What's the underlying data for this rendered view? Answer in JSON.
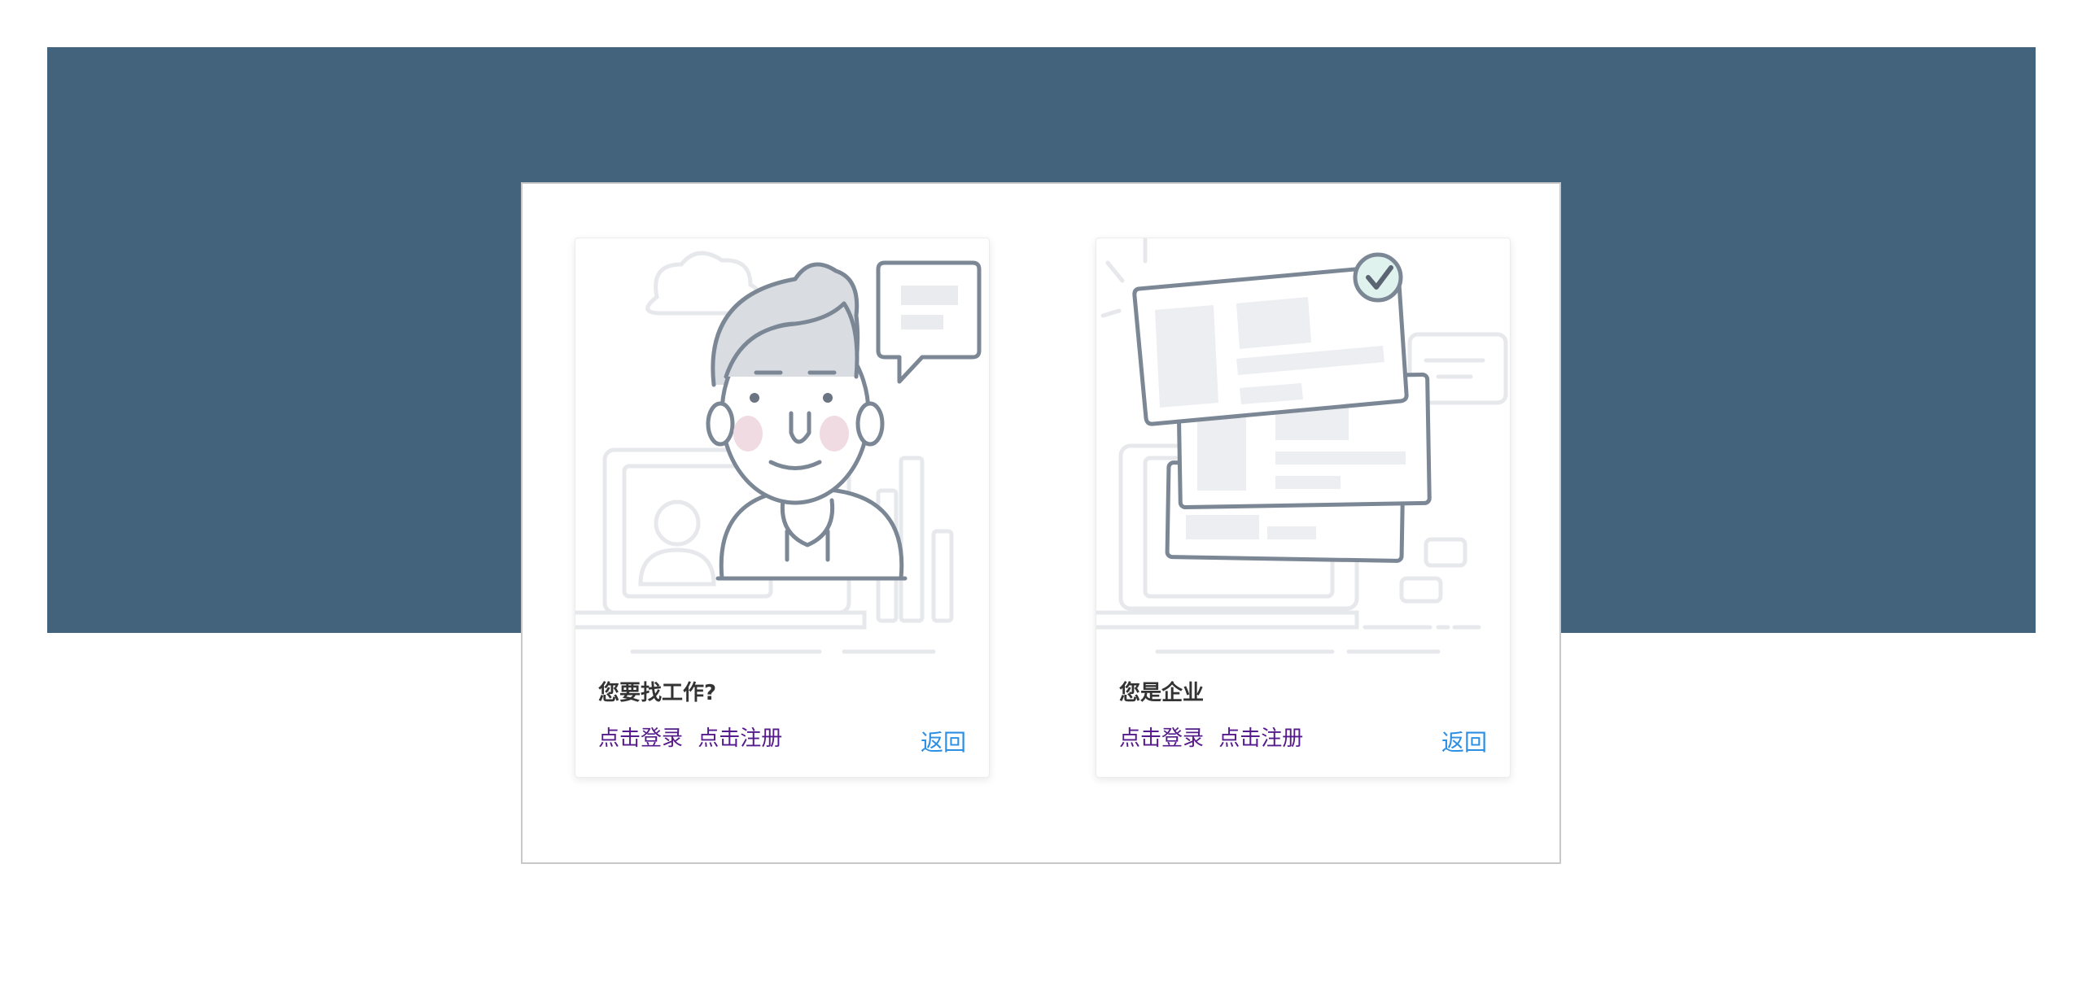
{
  "colors": {
    "banner": "#43637d",
    "link_visited": "#551a8b",
    "back_link": "#2d8fe3",
    "title_text": "#333333"
  },
  "cards": [
    {
      "illustration": "person-at-laptop-with-speech-bubble",
      "title": "您要找工作?",
      "login_label": "点击登录",
      "register_label": "点击注册",
      "back_label": "返回"
    },
    {
      "illustration": "stacked-documents-with-checkmark",
      "title": "您是企业",
      "login_label": "点击登录",
      "register_label": "点击注册",
      "back_label": "返回"
    }
  ]
}
